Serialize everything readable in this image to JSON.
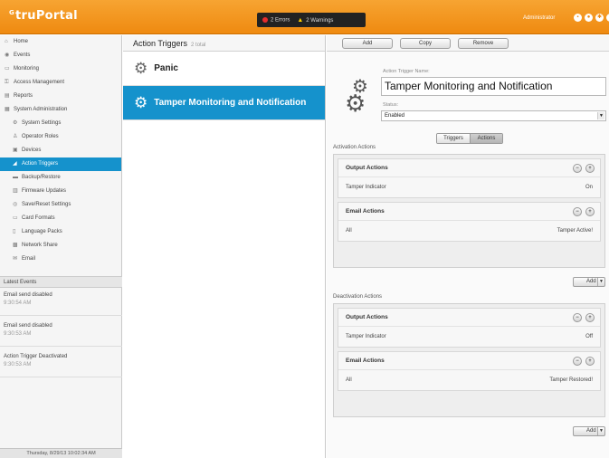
{
  "header": {
    "logo": "truPortal",
    "logo_mark": "G",
    "errors": "2 Errors",
    "warnings": "2 Warnings",
    "user": "Administrator",
    "icons": [
      "lock-icon",
      "user-icon",
      "settings-icon",
      "help-icon"
    ]
  },
  "sidebar": {
    "items": [
      {
        "label": "Home",
        "icon": "home-icon"
      },
      {
        "label": "Events",
        "icon": "events-icon"
      },
      {
        "label": "Monitoring",
        "icon": "monitor-icon"
      },
      {
        "label": "Access Management",
        "icon": "key-icon"
      },
      {
        "label": "Reports",
        "icon": "report-icon"
      },
      {
        "label": "System Administration",
        "icon": "admin-icon"
      },
      {
        "label": "System Settings",
        "icon": "gear-icon"
      },
      {
        "label": "Operator Roles",
        "icon": "roles-icon"
      },
      {
        "label": "Devices",
        "icon": "devices-icon"
      },
      {
        "label": "Action Triggers",
        "icon": "trigger-icon"
      },
      {
        "label": "Backup/Restore",
        "icon": "backup-icon"
      },
      {
        "label": "Firmware Updates",
        "icon": "firmware-icon"
      },
      {
        "label": "Save/Reset Settings",
        "icon": "save-icon"
      },
      {
        "label": "Card Formats",
        "icon": "card-icon"
      },
      {
        "label": "Language Packs",
        "icon": "language-icon"
      },
      {
        "label": "Network Share",
        "icon": "network-icon"
      },
      {
        "label": "Email",
        "icon": "email-icon"
      }
    ],
    "latest_events_title": "Latest Events",
    "events": [
      {
        "text": "Email send disabled",
        "time": "9:30:54 AM"
      },
      {
        "text": "Email send disabled",
        "time": "9:30:53 AM"
      },
      {
        "text": "Action Trigger Deactivated",
        "time": "9:30:53 AM"
      }
    ],
    "footer_date": "Thursday, 8/29/13 10:02:34 AM"
  },
  "middle": {
    "title": "Action Triggers",
    "count": "2 total",
    "triggers": [
      {
        "name": "Panic"
      },
      {
        "name": "Tamper Monitoring and Notification"
      }
    ]
  },
  "detail": {
    "buttons": {
      "add": "Add",
      "copy": "Copy",
      "remove": "Remove"
    },
    "name_label": "Action Trigger Name:",
    "name_value": "Tamper Monitoring and Notification",
    "status_label": "Status:",
    "status_value": "Enabled",
    "tabs": {
      "triggers": "Triggers",
      "actions": "Actions"
    },
    "activation": {
      "title": "Activation Actions",
      "output_title": "Output Actions",
      "output_row": {
        "label": "Tamper Indicator",
        "value": "On"
      },
      "email_title": "Email Actions",
      "email_row": {
        "label": "All",
        "value": "Tamper Active!"
      },
      "add": "Add"
    },
    "deactivation": {
      "title": "Deactivation Actions",
      "output_title": "Output Actions",
      "output_row": {
        "label": "Tamper Indicator",
        "value": "Off"
      },
      "email_title": "Email Actions",
      "email_row": {
        "label": "All",
        "value": "Tamper Restored!"
      },
      "add": "Add"
    }
  },
  "colors": {
    "brand": "#ef8a10",
    "selected": "#1592cc"
  }
}
